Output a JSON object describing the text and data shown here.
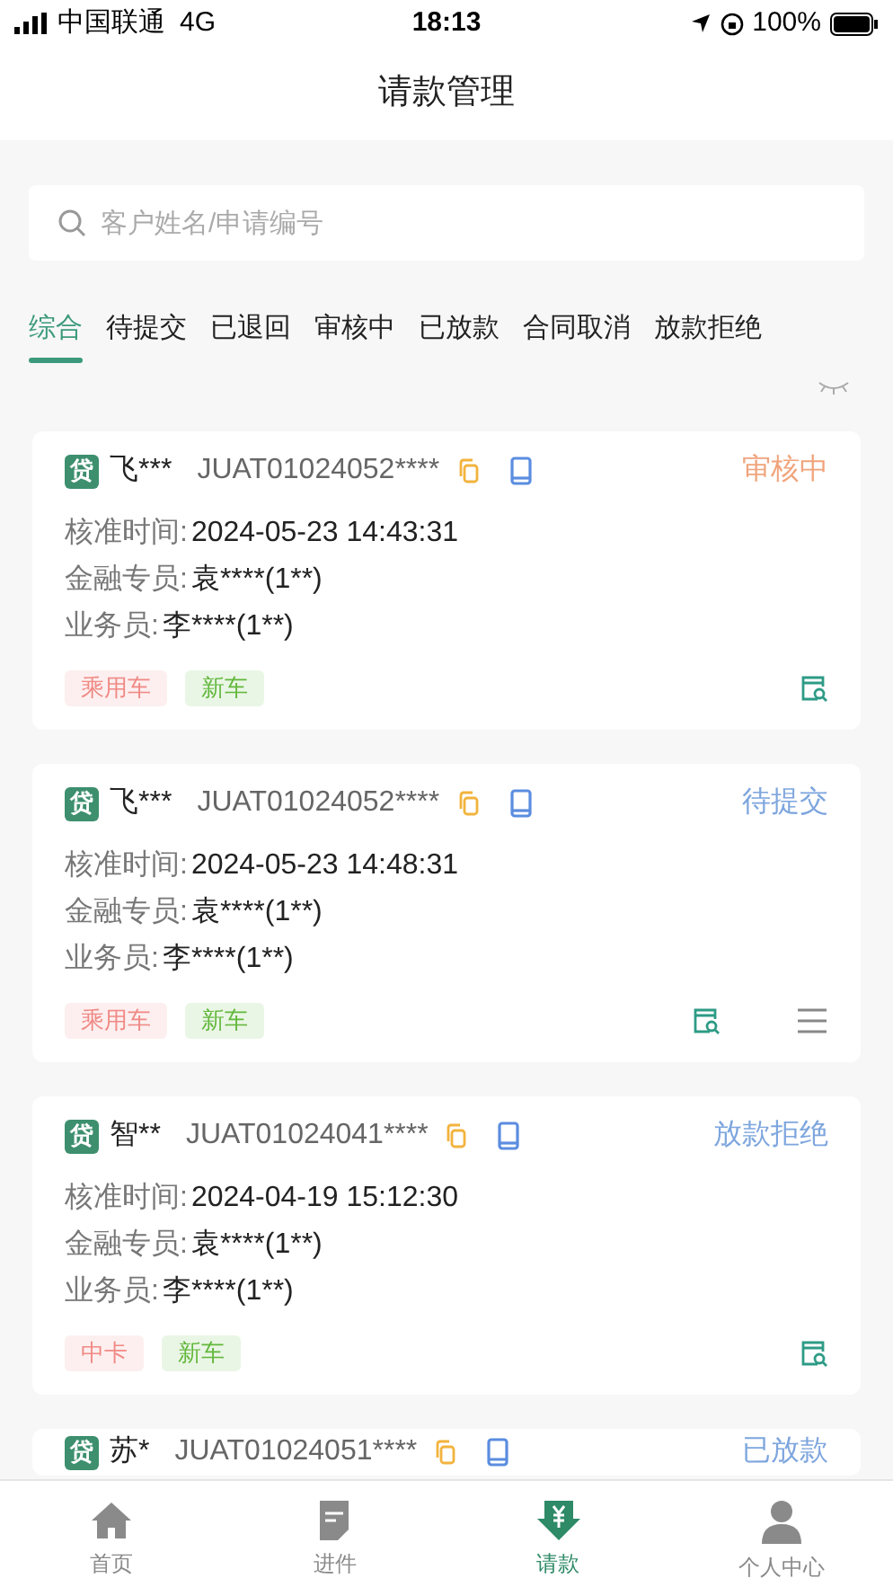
{
  "status_bar": {
    "carrier": "中国联通",
    "network": "4G",
    "time": "18:13",
    "battery": "100%"
  },
  "title": "请款管理",
  "search": {
    "placeholder": "客户姓名/申请编号"
  },
  "tabs": [
    {
      "label": "综合",
      "selected": true
    },
    {
      "label": "待提交",
      "selected": false
    },
    {
      "label": "已退回",
      "selected": false
    },
    {
      "label": "审核中",
      "selected": false
    },
    {
      "label": "已放款",
      "selected": false
    },
    {
      "label": "合同取消",
      "selected": false
    },
    {
      "label": "放款拒绝",
      "selected": false
    }
  ],
  "cards": [
    {
      "badge": "贷",
      "name": "飞***",
      "number": "JUAT01024052****",
      "status": "审核中",
      "color": "#f0a47c",
      "fields": [
        {
          "label": "核准时间:",
          "value": "2024-05-23 14:43:31"
        },
        {
          "label": "金融专员:",
          "value": "袁****(1**)"
        },
        {
          "label": "业务员:",
          "value": "李****(1**)"
        }
      ],
      "tags": [
        {
          "label": "乘用车",
          "color": "#f08a86"
        },
        {
          "label": "新车",
          "color": "#63b83e"
        }
      ],
      "actions": [
        {
          "kind": "view"
        }
      ]
    },
    {
      "badge": "贷",
      "name": "飞***",
      "number": "JUAT01024052****",
      "status": "待提交",
      "color": "#7ea6de",
      "fields": [
        {
          "label": "核准时间:",
          "value": "2024-05-23 14:48:31"
        },
        {
          "label": "金融专员:",
          "value": "袁****(1**)"
        },
        {
          "label": "业务员:",
          "value": "李****(1**)"
        }
      ],
      "tags": [
        {
          "label": "乘用车",
          "color": "#f08a86"
        },
        {
          "label": "新车",
          "color": "#63b83e"
        }
      ],
      "actions": [
        {
          "kind": "view"
        },
        {
          "kind": "menu"
        }
      ]
    },
    {
      "badge": "贷",
      "name": "智**",
      "number": "JUAT01024041****",
      "status": "放款拒绝",
      "color": "#7ea6de",
      "fields": [
        {
          "label": "核准时间:",
          "value": "2024-04-19 15:12:30"
        },
        {
          "label": "金融专员:",
          "value": "袁****(1**)"
        },
        {
          "label": "业务员:",
          "value": "李****(1**)"
        }
      ],
      "tags": [
        {
          "label": "中卡",
          "color": "#f08a86"
        },
        {
          "label": "新车",
          "color": "#63b83e"
        }
      ],
      "actions": [
        {
          "kind": "view"
        }
      ]
    },
    {
      "badge": "贷",
      "name": "苏*",
      "number": "JUAT01024051****",
      "status": "已放款",
      "color": "#7ea6de"
    }
  ],
  "nav": [
    {
      "label": "首页",
      "kind": "home",
      "selected": false
    },
    {
      "label": "进件",
      "kind": "form",
      "selected": false
    },
    {
      "label": "请款",
      "kind": "payment",
      "selected": true
    },
    {
      "label": "个人中心",
      "kind": "person",
      "selected": false
    }
  ]
}
